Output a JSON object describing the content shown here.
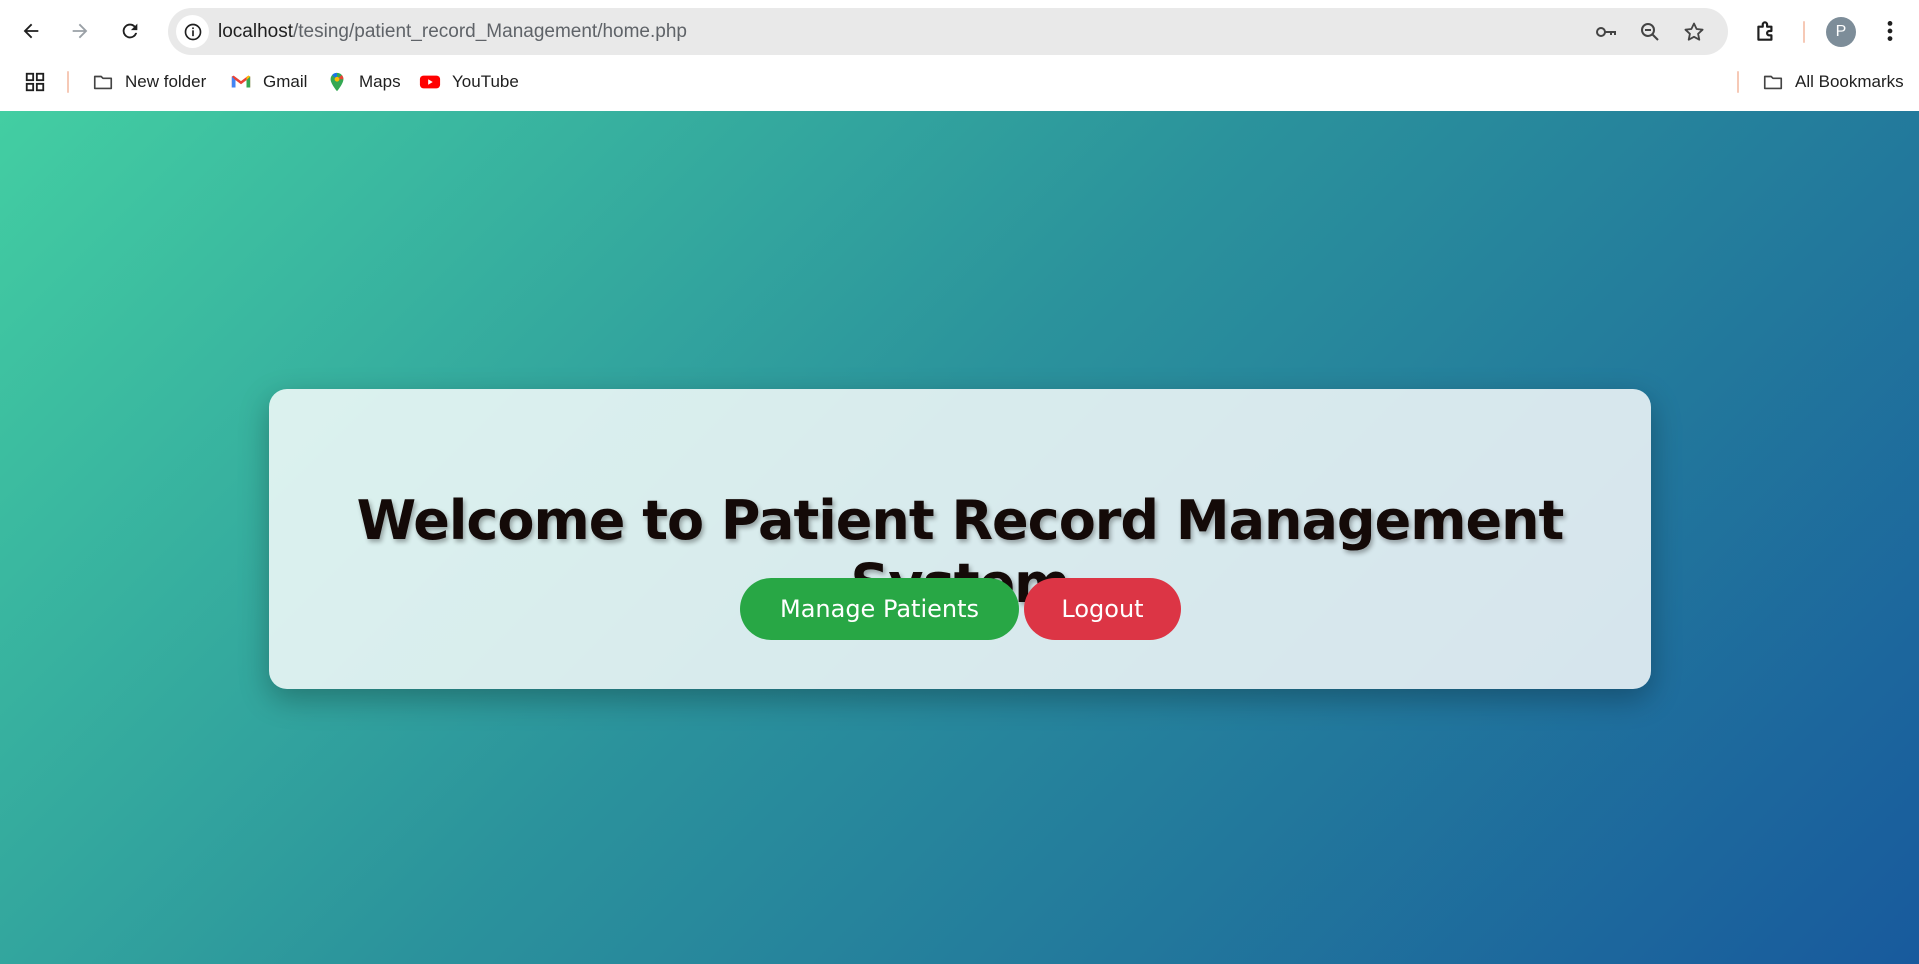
{
  "browser": {
    "url_host": "localhost",
    "url_path": "/tesing/patient_record_Management/home.php",
    "profile_initial": "P",
    "icons": {
      "back": "arrow-left-icon",
      "forward": "arrow-right-icon",
      "reload": "reload-icon",
      "site_info": "info-icon",
      "password": "key-icon",
      "zoom": "zoom-icon",
      "bookmark": "star-icon",
      "extensions": "puzzle-icon",
      "menu": "kebab-menu-icon"
    }
  },
  "bookmarks": {
    "items": [
      {
        "label": "New folder",
        "icon": "folder-icon"
      },
      {
        "label": "Gmail",
        "icon": "gmail-icon"
      },
      {
        "label": "Maps",
        "icon": "maps-icon"
      },
      {
        "label": "YouTube",
        "icon": "youtube-icon"
      }
    ],
    "all_label": "All Bookmarks"
  },
  "page": {
    "heading": "Welcome to Patient Record Management System",
    "buttons": {
      "manage": "Manage Patients",
      "logout": "Logout"
    },
    "colors": {
      "gradient_start": "#43cea2",
      "gradient_end": "#185a9d",
      "manage_button": "#28a745",
      "logout_button": "#dc3545"
    }
  }
}
